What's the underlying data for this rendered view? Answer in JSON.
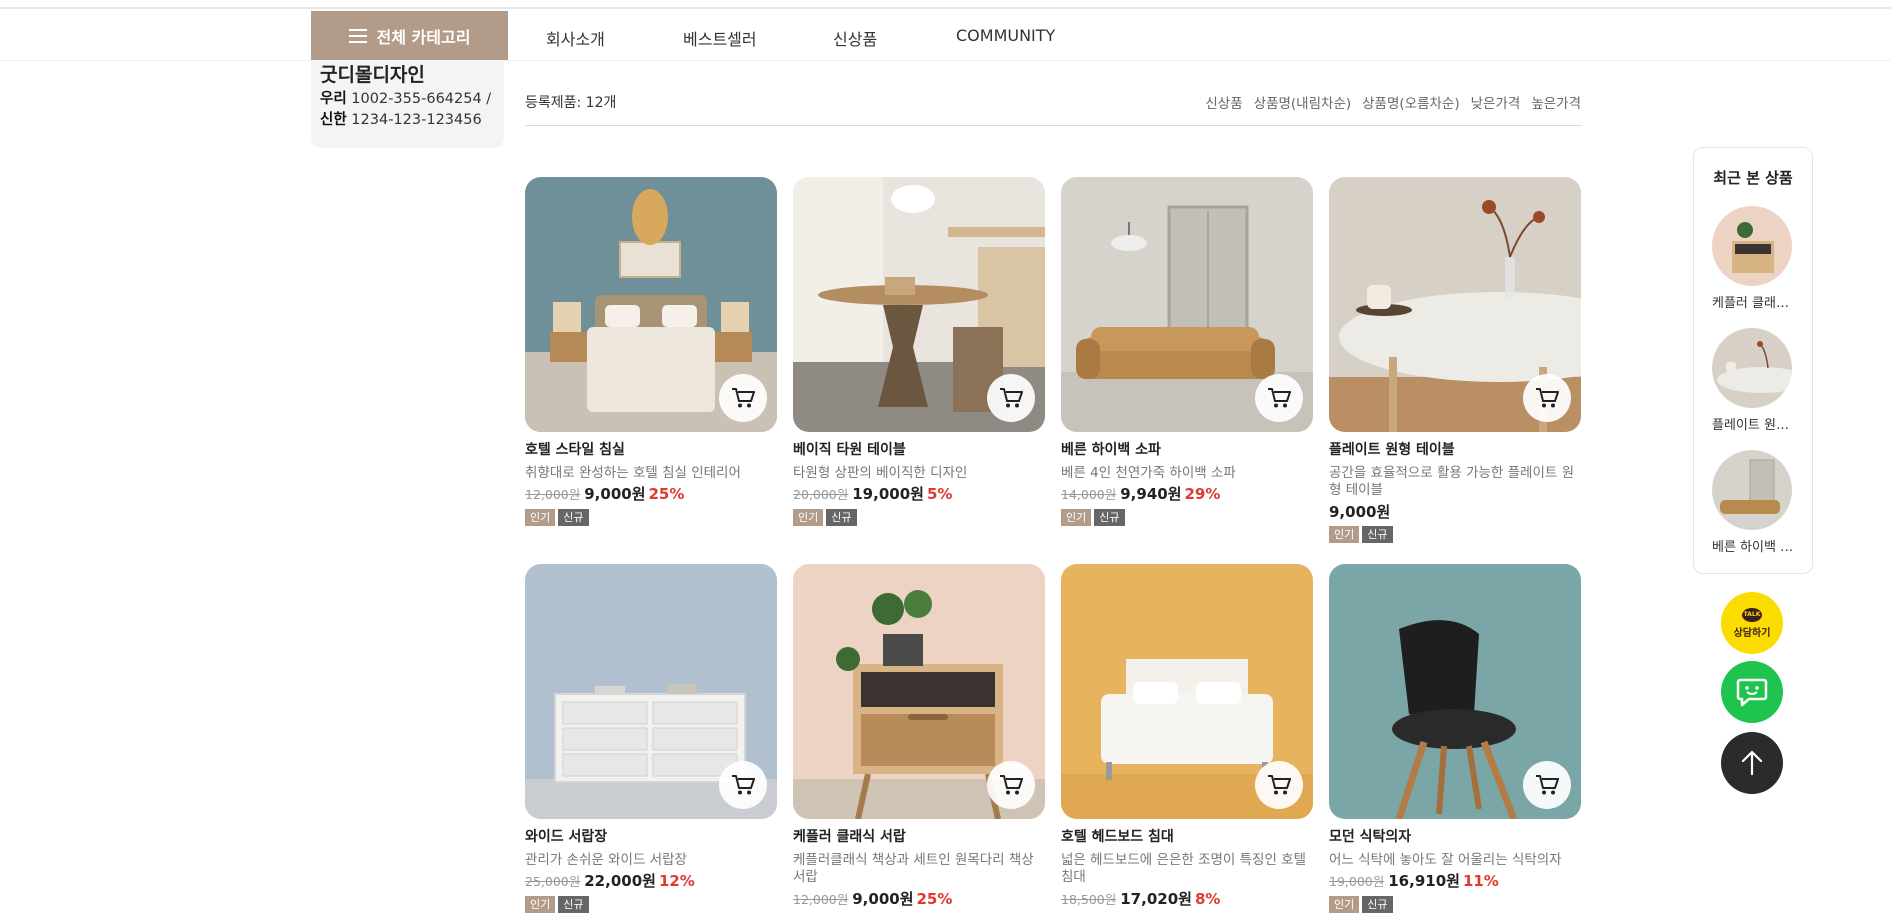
{
  "header": {
    "category_button": "전체 카테고리",
    "nav": [
      "회사소개",
      "베스트셀러",
      "신상품",
      "COMMUNITY"
    ]
  },
  "side_info": {
    "shop_name": "굿디몰디자인",
    "accounts": [
      {
        "bank": "우리",
        "number": "1002-355-664254 /"
      },
      {
        "bank": "신한",
        "number": "1234-123-123456"
      }
    ]
  },
  "list": {
    "count_text": "등록제품: 12개",
    "sort_options": [
      "신상품",
      "상품명(내림차순)",
      "상품명(오름차순)",
      "낮은가격",
      "높은가격"
    ]
  },
  "products": [
    {
      "name": "호텔 스타일 침실",
      "desc": "취향대로 완성하는 호텔 침실 인테리어",
      "orig": "12,000원",
      "price": "9,000원",
      "rate": "25%",
      "badges": [
        "인기",
        "신규"
      ],
      "icon": "bed-scene"
    },
    {
      "name": "베이직 타원 테이블",
      "desc": "타원형 상판의 베이직한 디자인",
      "orig": "20,000원",
      "price": "19,000원",
      "rate": "5%",
      "badges": [
        "인기",
        "신규"
      ],
      "icon": "table-scene"
    },
    {
      "name": "베른 하이백 소파",
      "desc": "베른 4인 천연가죽 하이백 소파",
      "orig": "14,000원",
      "price": "9,940원",
      "rate": "29%",
      "badges": [
        "인기",
        "신규"
      ],
      "icon": "sofa-scene"
    },
    {
      "name": "플레이트 원형 테이블",
      "desc": "공간을 효율적으로 활용 가능한 플레이트 원형 테이블",
      "orig": "",
      "price": "9,000원",
      "rate": "",
      "badges": [
        "인기",
        "신규"
      ],
      "icon": "round-table-scene"
    },
    {
      "name": "와이드 서랍장",
      "desc": "관리가 손쉬운 와이드 서랍장",
      "orig": "25,000원",
      "price": "22,000원",
      "rate": "12%",
      "badges": [
        "인기",
        "신규"
      ],
      "icon": "dresser-scene"
    },
    {
      "name": "케플러 클래식 서랍",
      "desc": "케플러클래식 책상과 세트인 원목다리 책상서랍",
      "orig": "12,000원",
      "price": "9,000원",
      "rate": "25%",
      "badges": [
        "인기",
        "신규"
      ],
      "icon": "nightstand-scene"
    },
    {
      "name": "호텔 헤드보드 침대",
      "desc": "넓은 헤드보드에 은은한 조명이 특징인 호텔 침대",
      "orig": "18,500원",
      "price": "17,020원",
      "rate": "8%",
      "badges": [
        "인기",
        "신규"
      ],
      "icon": "headboard-bed-scene"
    },
    {
      "name": "모던 식탁의자",
      "desc": "어느 식탁에 놓아도 잘 어울리는 식탁의자",
      "orig": "19,000원",
      "price": "16,910원",
      "rate": "11%",
      "badges": [
        "인기",
        "신규"
      ],
      "icon": "chair-scene"
    }
  ],
  "recent": {
    "title": "최근 본 상품",
    "items": [
      {
        "name": "케플러 클래식 서랍"
      },
      {
        "name": "플레이트 원형 테이블"
      },
      {
        "name": "베른 하이백 소파"
      }
    ]
  },
  "floating": {
    "kakao_badge": "TALK",
    "kakao_label": "상담하기"
  },
  "colors": {
    "accent": "#b39b89",
    "sale_rate": "#e03a2f",
    "kakao": "#fbdc00",
    "chat": "#1fc44e",
    "top_button": "#2b2b2b"
  }
}
